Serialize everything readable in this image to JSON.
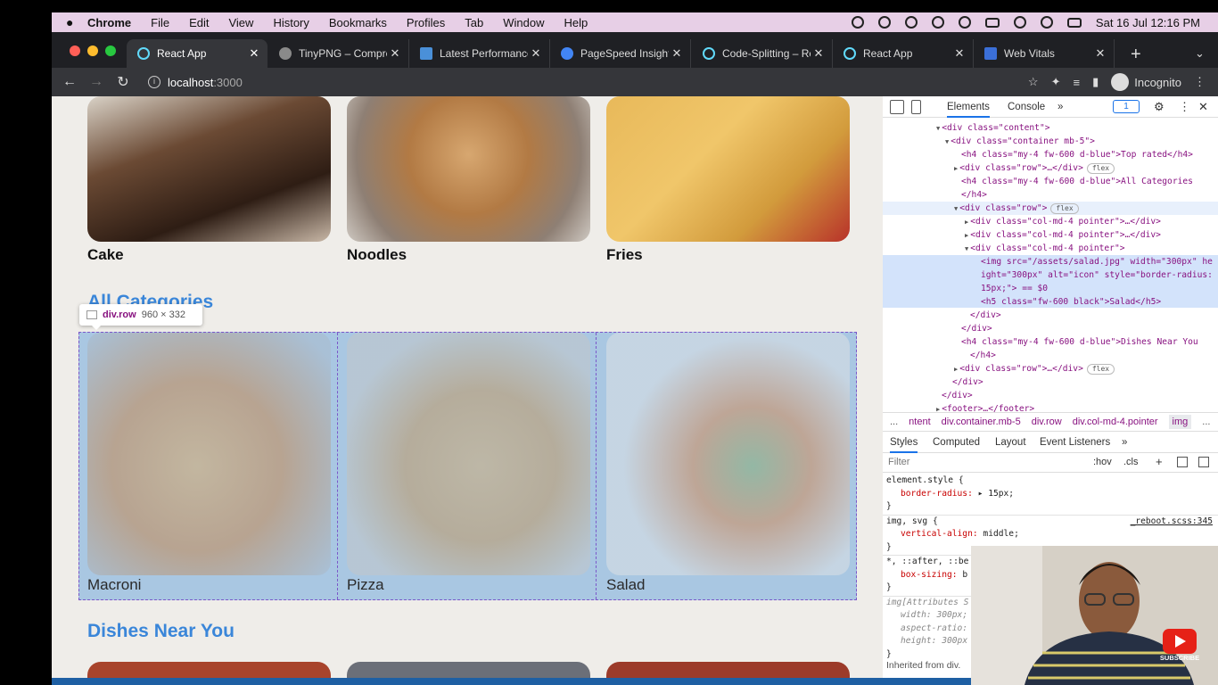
{
  "menubar": {
    "app": "Chrome",
    "items": [
      "File",
      "Edit",
      "View",
      "History",
      "Bookmarks",
      "Profiles",
      "Tab",
      "Window",
      "Help"
    ],
    "datetime": "Sat 16 Jul  12:16 PM"
  },
  "tabs": [
    {
      "label": "React App",
      "active": true,
      "color": "#61dafb"
    },
    {
      "label": "TinyPNG – Compre",
      "active": false,
      "color": "#8a8a8a"
    },
    {
      "label": "Latest Performance",
      "active": false,
      "color": "#4a90d9"
    },
    {
      "label": "PageSpeed Insights",
      "active": false,
      "color": "#4285f4"
    },
    {
      "label": "Code-Splitting – Re",
      "active": false,
      "color": "#61dafb"
    },
    {
      "label": "React App",
      "active": false,
      "color": "#61dafb"
    },
    {
      "label": "Web Vitals",
      "active": false,
      "color": "#3b6fd8"
    }
  ],
  "address": {
    "host": "localhost",
    "port": ":3000"
  },
  "incognito": "Incognito",
  "page": {
    "top_cards": [
      {
        "name": "Cake"
      },
      {
        "name": "Noodles"
      },
      {
        "name": "Fries"
      }
    ],
    "all_categories": "All Categories",
    "categories": [
      {
        "name": "Macroni"
      },
      {
        "name": "Pizza"
      },
      {
        "name": "Salad"
      }
    ],
    "dishes_near_you": "Dishes Near You"
  },
  "tooltip": {
    "selector": "div.row",
    "size": "960 × 332"
  },
  "devtools": {
    "tabs": [
      "Elements",
      "Console"
    ],
    "badge": "1",
    "style_tabs": [
      "Styles",
      "Computed",
      "Layout",
      "Event Listeners"
    ],
    "filter_placeholder": "Filter",
    "filter_tools": [
      ":hov",
      ".cls",
      "+"
    ],
    "breadcrumbs": [
      "...",
      "ntent",
      "div.container.mb-5",
      "div.row",
      "div.col-md-4.pointer",
      "img",
      "..."
    ],
    "inherited": "Inherited from div."
  },
  "dom_lines": [
    {
      "indent": 60,
      "arrow": "▼",
      "text": "<div class=\"content\">"
    },
    {
      "indent": 70,
      "arrow": "▼",
      "text": "<div class=\"container mb-5\">"
    },
    {
      "indent": 88,
      "arrow": "",
      "text": "<h4 class=\"my-4 fw-600 d-blue\">Top rated</h4>"
    },
    {
      "indent": 80,
      "arrow": "▶",
      "text": "<div class=\"row\">…</div>",
      "pill": "flex"
    },
    {
      "indent": 88,
      "arrow": "",
      "text": "<h4 class=\"my-4 fw-600 d-blue\">All Categories"
    },
    {
      "indent": 88,
      "arrow": "",
      "text": "</h4>"
    },
    {
      "indent": 80,
      "arrow": "▼",
      "text": "<div class=\"row\">",
      "pill": "flex",
      "hover": true
    },
    {
      "indent": 92,
      "arrow": "▶",
      "text": "<div class=\"col-md-4 pointer\">…</div>"
    },
    {
      "indent": 92,
      "arrow": "▶",
      "text": "<div class=\"col-md-4 pointer\">…</div>"
    },
    {
      "indent": 92,
      "arrow": "▼",
      "text": "<div class=\"col-md-4 pointer\">"
    },
    {
      "indent": 110,
      "arrow": "",
      "text": "<img src=\"/assets/salad.jpg\" width=\"300px\" height=\"300px\" alt=\"icon\" style=\"border-radius: 15px;\"> == $0",
      "selected": true
    },
    {
      "indent": 110,
      "arrow": "",
      "text": "<h5 class=\"fw-600 black\">Salad</h5>"
    },
    {
      "indent": 98,
      "arrow": "",
      "text": "</div>"
    },
    {
      "indent": 88,
      "arrow": "",
      "text": "</div>"
    },
    {
      "indent": 88,
      "arrow": "",
      "text": "<h4 class=\"my-4 fw-600 d-blue\">Dishes Near You"
    },
    {
      "indent": 98,
      "arrow": "",
      "text": "</h4>"
    },
    {
      "indent": 80,
      "arrow": "▶",
      "text": "<div class=\"row\">…</div>",
      "pill": "flex"
    },
    {
      "indent": 78,
      "arrow": "",
      "text": "</div>"
    },
    {
      "indent": 66,
      "arrow": "",
      "text": "</div>"
    },
    {
      "indent": 60,
      "arrow": "▶",
      "text": "<footer>…</footer>"
    }
  ],
  "css_rules": [
    {
      "kind": "sel",
      "text": "element.style {"
    },
    {
      "kind": "prop",
      "name": "border-radius",
      "value": "▸ 15px;"
    },
    {
      "kind": "close",
      "text": "}"
    },
    {
      "kind": "sel",
      "text": "img, svg {",
      "source": "_reboot.scss:345"
    },
    {
      "kind": "prop",
      "name": "vertical-align",
      "value": "middle;"
    },
    {
      "kind": "close",
      "text": "}"
    },
    {
      "kind": "sel",
      "text": "*, ::after, ::be"
    },
    {
      "kind": "prop",
      "name": "box-sizing",
      "value": "b"
    },
    {
      "kind": "close",
      "text": "}"
    },
    {
      "kind": "ua",
      "text": "img[Attributes S"
    },
    {
      "kind": "uaprop",
      "name": "width",
      "value": "300px;"
    },
    {
      "kind": "uaprop",
      "name": "aspect-ratio",
      "value": ""
    },
    {
      "kind": "uaprop",
      "name": "height",
      "value": "300px"
    },
    {
      "kind": "close",
      "text": "}"
    }
  ],
  "subscribe_label": "SUBSCRIBE"
}
